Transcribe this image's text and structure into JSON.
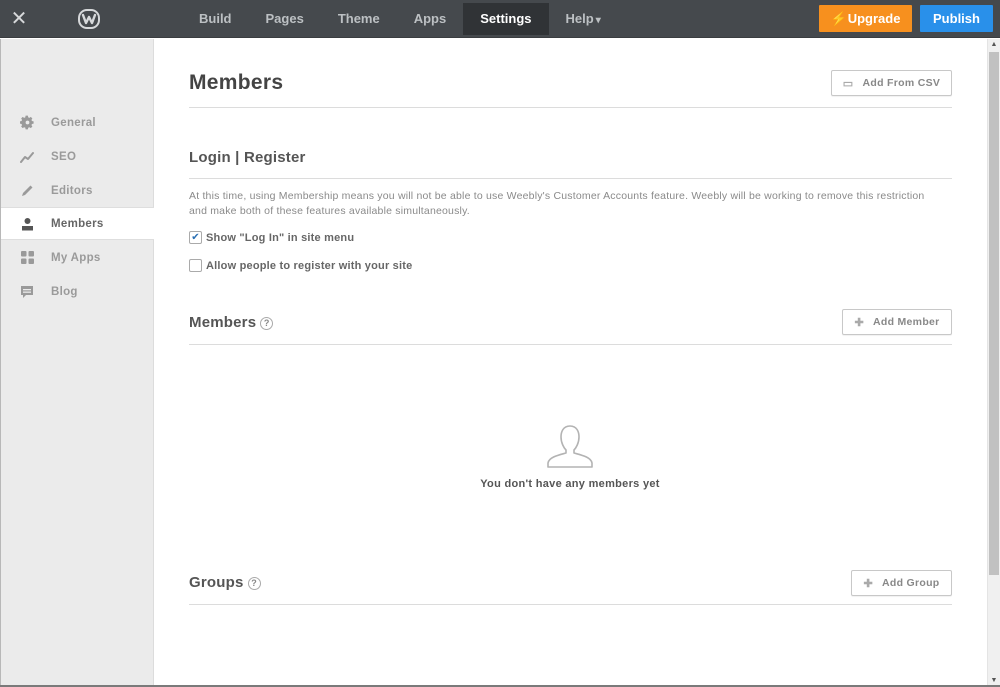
{
  "topbar": {
    "close_icon": "close-icon",
    "logo_icon": "weebly-logo",
    "nav": [
      {
        "label": "Build",
        "active": false
      },
      {
        "label": "Pages",
        "active": false
      },
      {
        "label": "Theme",
        "active": false
      },
      {
        "label": "Apps",
        "active": false
      },
      {
        "label": "Settings",
        "active": true
      },
      {
        "label": "Help",
        "active": false,
        "dropdown": true
      }
    ],
    "upgrade_label": "Upgrade",
    "publish_label": "Publish",
    "colors": {
      "bar": "#45494d",
      "upgrade": "#f7901e",
      "publish": "#2990ea"
    }
  },
  "sidebar": {
    "items": [
      {
        "label": "General",
        "icon": "gear-icon",
        "active": false
      },
      {
        "label": "SEO",
        "icon": "trend-icon",
        "active": false
      },
      {
        "label": "Editors",
        "icon": "pencil-icon",
        "active": false
      },
      {
        "label": "Members",
        "icon": "user-icon",
        "active": true
      },
      {
        "label": "My Apps",
        "icon": "grid-icon",
        "active": false
      },
      {
        "label": "Blog",
        "icon": "comment-icon",
        "active": false
      }
    ]
  },
  "main": {
    "title": "Members",
    "add_csv_label": "Add From CSV",
    "login_section": {
      "title": "Login | Register",
      "notice": "At this time, using Membership means you will not be able to use Weebly's Customer Accounts feature. Weebly will be working to remove this restriction and make both of these features available simultaneously.",
      "options": [
        {
          "label": "Show \"Log In\" in site menu",
          "checked": true
        },
        {
          "label": "Allow people to register with your site",
          "checked": false
        }
      ]
    },
    "members_section": {
      "title": "Members",
      "help": "?",
      "add_label": "Add Member",
      "empty_text": "You don't have any members yet"
    },
    "groups_section": {
      "title": "Groups",
      "help": "?",
      "add_label": "Add Group"
    }
  }
}
